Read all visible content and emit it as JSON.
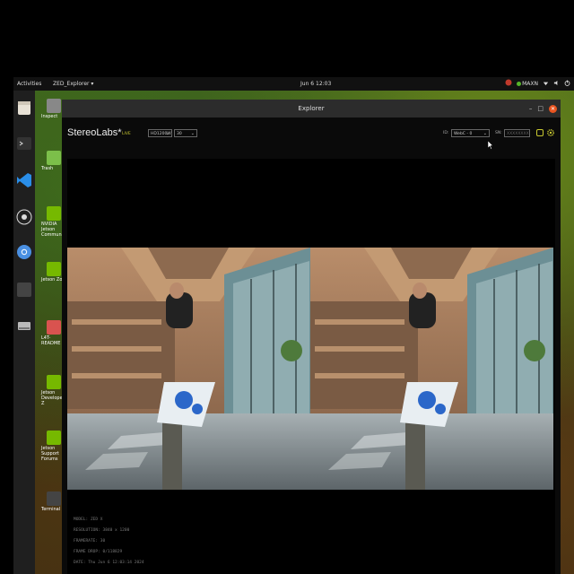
{
  "topbar": {
    "activities": "Activities",
    "app_menu": "ZED_Explorer ▾",
    "clock": "Jun 6  12:03",
    "power_mode": "MAXN"
  },
  "desktop_icons": [
    {
      "label": "Inspect"
    },
    {
      "label": "Trash"
    },
    {
      "label": "NVIDIA Jetson Community"
    },
    {
      "label": "Jetson Zoo"
    },
    {
      "label": "L4T-README"
    },
    {
      "label": "Jetson Developer Z"
    },
    {
      "label": "Jetson Support Forums"
    },
    {
      "label": "Terminal"
    }
  ],
  "window": {
    "title": "Explorer",
    "brand": "StereoLabs*",
    "status": "LIVE",
    "resolution_select": "HD1200W",
    "fps_select": "30",
    "sn_label": "ID:",
    "serial_select": "WebC - 0",
    "svo_label": "SN:",
    "svo_placeholder": "XXXXXXXX"
  },
  "camera_info": {
    "model": "MODEL: ZED X",
    "resolution": "RESOLUTION: 3840 x 1200",
    "framerate": "FRAMERATE: 30",
    "frame_drop": "FRAME DROP: 0/118829",
    "date": "DATE: Thu Jun 6 12:03:14 2024"
  },
  "colors": {
    "accent": "#e95420",
    "live": "#c8c830",
    "maxn_indicator": "#56b52a"
  }
}
